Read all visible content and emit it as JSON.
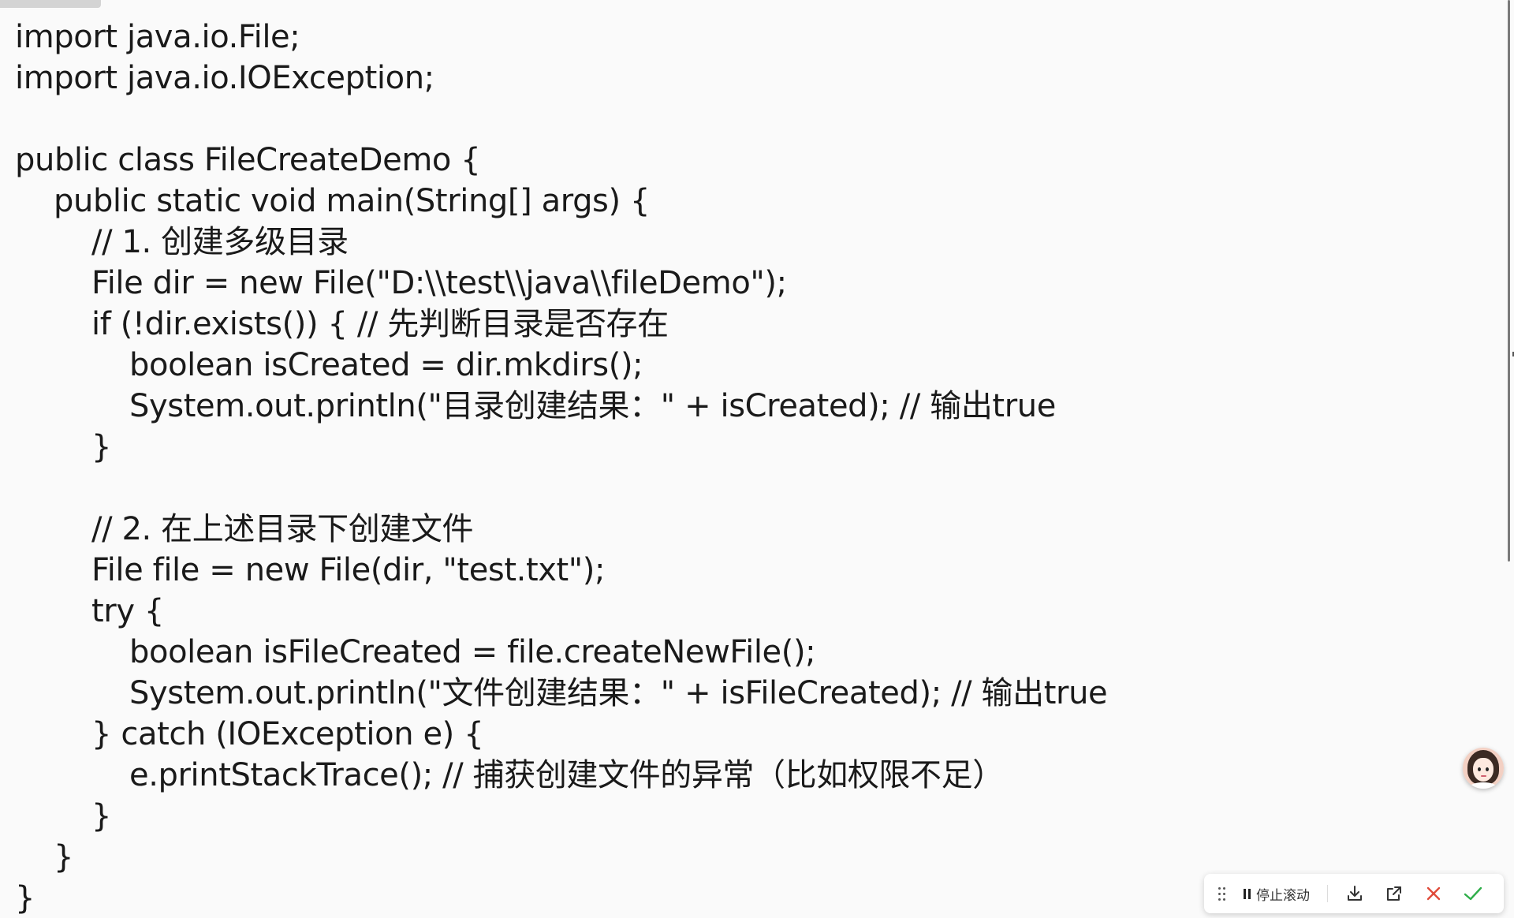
{
  "code": {
    "lines": [
      "import java.io.File;",
      "import java.io.IOException;",
      "",
      "public class FileCreateDemo {",
      "public static void main(String[] args) {",
      "// 1. 创建多级目录",
      "File dir = new File(\"D:\\\\test\\\\java\\\\fileDemo\");",
      "if (!dir.exists()) { // 先判断目录是否存在",
      "boolean isCreated = dir.mkdirs();",
      "System.out.println(\"目录创建结果：\" + isCreated); // 输出true",
      "}",
      "",
      "// 2. 在上述目录下创建文件",
      "File file = new File(dir, \"test.txt\");",
      "try {",
      "boolean isFileCreated = file.createNewFile();",
      "System.out.println(\"文件创建结果：\" + isFileCreated); // 输出true",
      "} catch (IOException e) {",
      "e.printStackTrace(); // 捕获创建文件的异常（比如权限不足）",
      "}",
      "}",
      "}"
    ]
  },
  "toolbar": {
    "drag_handle_icon": "drag-handle-icon",
    "stop_scroll_label": "停止滚动",
    "download_icon": "download-icon",
    "open_external_icon": "open-external-icon",
    "close_icon": "close-icon",
    "confirm_icon": "check-icon"
  },
  "colors": {
    "code_text": "#1a1a1a",
    "background": "#fafafa",
    "close": "#e04b3a",
    "confirm": "#2fae4a"
  }
}
